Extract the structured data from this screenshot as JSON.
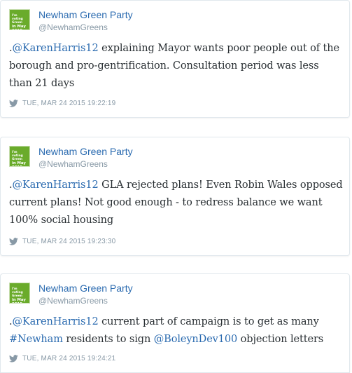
{
  "colors": {
    "link": "#2b6bb0",
    "text": "#292f33",
    "muted": "#8899a6",
    "avatar_bg": "#6aab2b"
  },
  "icons": {
    "avatar": "green-party-logo",
    "timestamp": "twitter-bird-icon"
  },
  "tweets": [
    {
      "name": "Newham Green Party",
      "handle": "@NewhamGreens",
      "avatar_lines": [
        "I'm voting Green",
        "in May 2015"
      ],
      "text": {
        "prefix": ".",
        "mention": "@KarenHarris12",
        "rest": " explaining Mayor wants poor people out of the borough and pro-gentrification. Consultation period was less than 21 days"
      },
      "timestamp": "TUE, MAR 24 2015 19:22:19"
    },
    {
      "name": "Newham Green Party",
      "handle": "@NewhamGreens",
      "avatar_lines": [
        "I'm voting Green",
        "in May 2015"
      ],
      "text": {
        "prefix": ".",
        "mention": "@KarenHarris12",
        "rest": " GLA rejected plans! Even Robin Wales opposed current plans! Not good enough - to redress balance we want 100% social housing"
      },
      "timestamp": "TUE, MAR 24 2015 19:23:30"
    },
    {
      "name": "Newham Green Party",
      "handle": "@NewhamGreens",
      "avatar_lines": [
        "I'm voting Green",
        "in May 2015"
      ],
      "text": {
        "prefix": ".",
        "mention": "@KarenHarris12",
        "mid1": " current part of campaign is to get as many ",
        "hashtag": "#Newham",
        "mid2": " residents to sign ",
        "mention2": "@BoleynDev100",
        "rest": " objection letters"
      },
      "timestamp": "TUE, MAR 24 2015 19:24:21"
    }
  ]
}
